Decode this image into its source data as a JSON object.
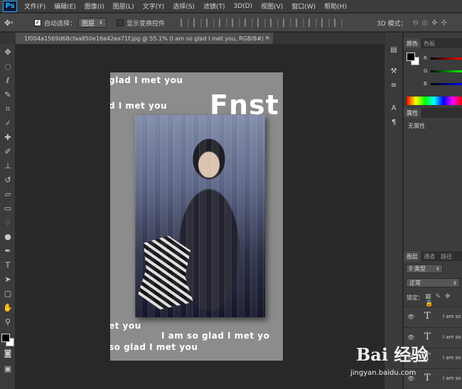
{
  "menubar": {
    "logo": "Ps",
    "items": [
      "文件(F)",
      "编辑(E)",
      "图像(I)",
      "图层(L)",
      "文字(Y)",
      "选择(S)",
      "滤镜(T)",
      "3D(D)",
      "视图(V)",
      "窗口(W)",
      "帮助(H)"
    ]
  },
  "options": {
    "auto_select_label": "自动选择：",
    "auto_select_checked": true,
    "auto_select_target": "图层",
    "show_transform_label": "显示变换控件",
    "show_transform_checked": false,
    "mode_3d_label": "3D 模式："
  },
  "document": {
    "tab_title": "1f004a1569d68cfaa850e16e42ea71f.jpg @ 55.1% (I am so glad I met you, RGB/8#) *",
    "close_glyph": "×",
    "texts": {
      "line1": "glad I met you",
      "line2": "d I met you",
      "big_word": "Fnst",
      "line3": "et you",
      "line4": "I am so glad I met yo",
      "line5": "so glad I met you"
    }
  },
  "panels": {
    "color_tab": "颜色",
    "swatches_tab": "色板",
    "channels": [
      "R",
      "G",
      "B"
    ],
    "properties_tab": "属性",
    "properties_text": "无属性",
    "layers_tab": "图层",
    "layers_tab2": "通道",
    "layers_tab3": "路径",
    "filter_label": "类型",
    "blend_mode": "正常",
    "lock_label": "锁定：",
    "layers": [
      {
        "name": "I am so"
      },
      {
        "name": "I am so"
      },
      {
        "name": "I am so"
      },
      {
        "name": "I am so"
      }
    ]
  },
  "watermark": {
    "main": "Bai 经验",
    "url": "jingyan.baidu.com"
  },
  "colors": {
    "menubar": "#3c3c3c",
    "canvas_bg": "#282828",
    "doc_bg": "#8c8c8c",
    "accent_ps": "#31a8ff"
  }
}
